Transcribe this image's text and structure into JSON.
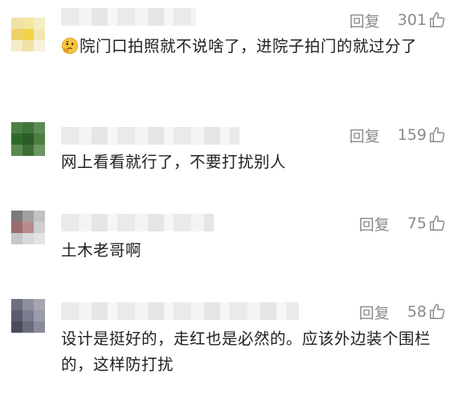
{
  "comments": [
    {
      "reply_label": "回复",
      "likes": "301",
      "emoji": "thinking-face-emoji",
      "text": "院门口拍照就不说啥了，进院子拍门的就过分了",
      "avatar_colors": [
        "#ece2a8",
        "#f2e6a0",
        "#f4eec2",
        "#efd36a",
        "#f3d24c",
        "#f1e7b0",
        "#f5eccc",
        "#efe3a6",
        "#f7f2dc"
      ]
    },
    {
      "reply_label": "回复",
      "likes": "159",
      "text": "网上看看就行了，不要打扰别人",
      "avatar_colors": [
        "#4f7f45",
        "#3f7638",
        "#5d8d53",
        "#2f6a2a",
        "#2b5e26",
        "#4d7d40",
        "#5a8a4c",
        "#3d6e36",
        "#6a9660"
      ]
    },
    {
      "reply_label": "回复",
      "likes": "75",
      "text": "土木老哥啊",
      "avatar_colors": [
        "#7e7a7a",
        "#a0a0a2",
        "#c2c2c2",
        "#9a6c6e",
        "#b88a8c",
        "#cfcfd1",
        "#c7c7c9",
        "#d9d9db",
        "#e3e3e5"
      ]
    },
    {
      "reply_label": "回复",
      "likes": "58",
      "text": "设计是挺好的，走红也是必然的。应该外边装个围栏的，这样防打扰",
      "avatar_colors": [
        "#6c6f80",
        "#8e90a0",
        "#a6a6b2",
        "#5a5c6e",
        "#7a7c8e",
        "#9a9cac",
        "#4a4c5c",
        "#6a6c7e",
        "#8a8c9c"
      ]
    }
  ]
}
